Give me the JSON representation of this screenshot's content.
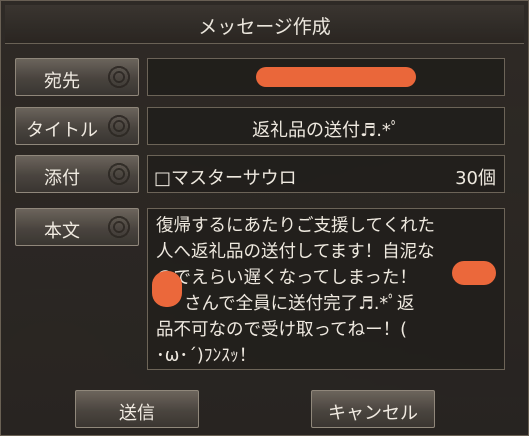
{
  "window": {
    "title": "メッセージ作成"
  },
  "form": {
    "recipient_label": "宛先",
    "recipient_value": "",
    "title_label": "タイトル",
    "title_value": "返礼品の送付♬.*ﾟ",
    "attachment_label": "添付",
    "attachment_item": "□マスターサウロ",
    "attachment_count": "30個",
    "body_label": "本文",
    "body_lines": [
      "復帰するにあたりご支援してくれた",
      "人へ返礼品の送付してます！自泥な",
      "のでえらい遅くなってしまった！",
      "さんで全員に送付完了♬.*ﾟ返",
      "品不可なので受け取ってねー！(",
      "･ω･´)ﾌﾝｽｯ！"
    ]
  },
  "buttons": {
    "send": "送信",
    "cancel": "キャンセル"
  },
  "colors": {
    "redaction": "#f06a3c",
    "panel": "#262321",
    "text": "#f4efe6"
  }
}
